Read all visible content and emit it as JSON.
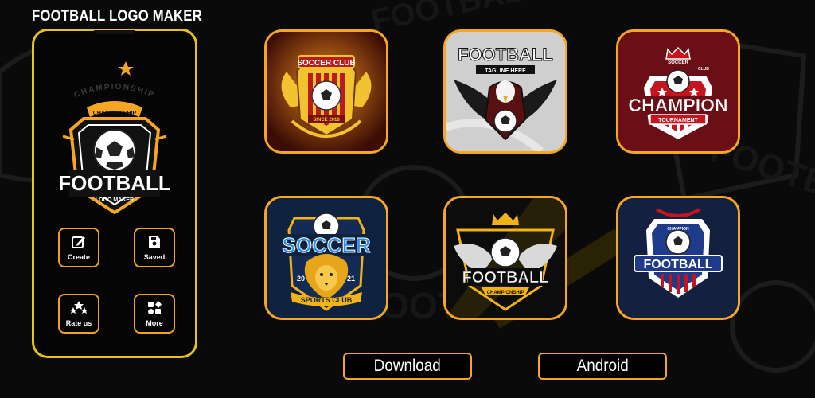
{
  "header": {
    "title": "FOOTBALL LOGO MAKER"
  },
  "phone": {
    "logo": {
      "arc_text": "CHAMPIONSHIP",
      "wordmark": "FOOTBALL",
      "sub": "LOGO MAKER"
    },
    "buttons": [
      {
        "label": "Create",
        "icon": "pencil-square-icon"
      },
      {
        "label": "Saved",
        "icon": "floppy-disk-icon"
      },
      {
        "label": "Rate us",
        "icon": "stars-icon"
      },
      {
        "label": "More",
        "icon": "shapes-grid-icon"
      }
    ]
  },
  "templates": [
    {
      "name": "soccer-club-wings",
      "title": "SOCCER CLUB",
      "extra": "SINCE 2018"
    },
    {
      "name": "football-eagle",
      "title": "FOOTBALL",
      "extra": "TAGLINE HERE"
    },
    {
      "name": "champion-tournament",
      "title": "CHAMPION",
      "extra": "TOURNAMENT",
      "small": "SOCCER",
      "small2": "CLUB"
    },
    {
      "name": "soccer-lion",
      "title": "SOCCER",
      "extra": "SPORTS CLUB",
      "num1": "20",
      "num2": "21"
    },
    {
      "name": "football-crown",
      "title": "FOOTBALL",
      "extra": "CHAMPIONSHIP"
    },
    {
      "name": "football-shield",
      "title": "FOOTBALL",
      "extra": "CHAMPION"
    }
  ],
  "actions": {
    "download": "Download",
    "android": "Android"
  },
  "colors": {
    "accent": "#f5a623",
    "phone_border": "#e8c21b",
    "background": "#0a0a0a"
  }
}
